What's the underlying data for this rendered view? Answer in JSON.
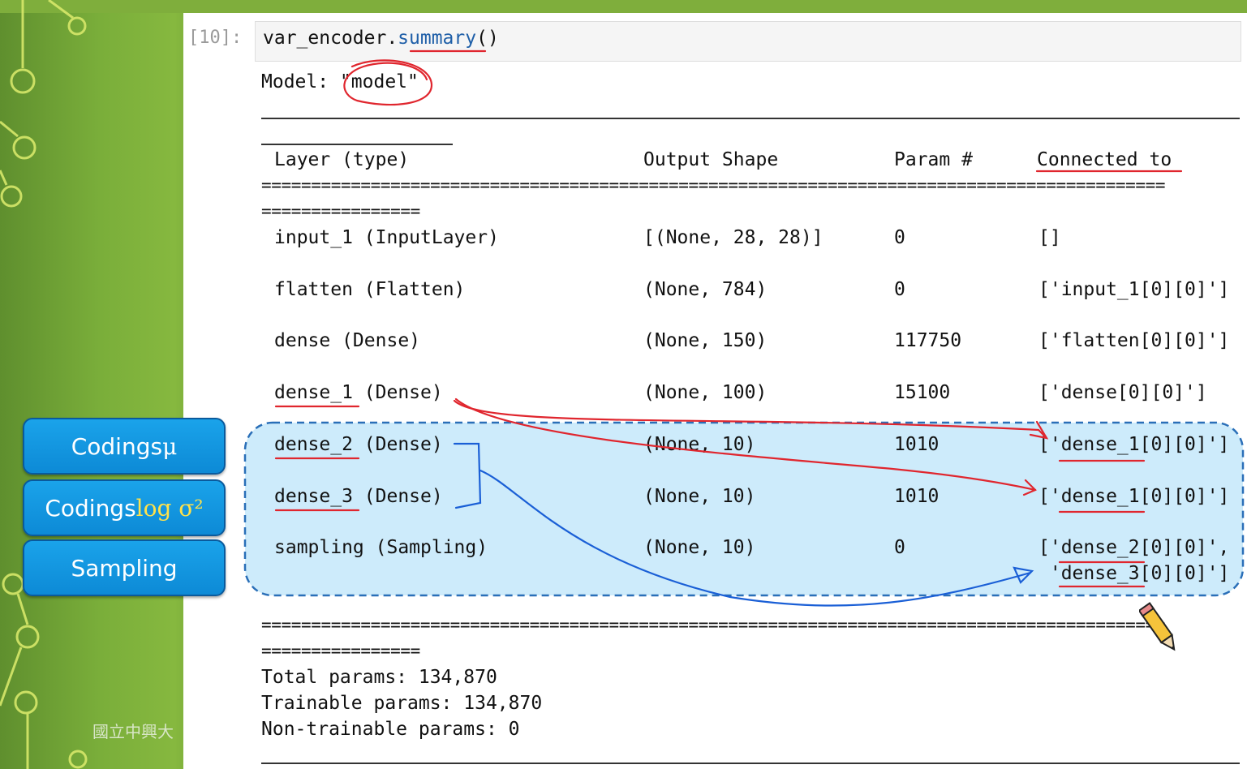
{
  "cell": {
    "prompt": "[10]:",
    "code_object": "var_encoder.",
    "code_method": "summary",
    "code_tail": "()"
  },
  "summary": {
    "model_label": "Model: ",
    "model_name": "\"model\"",
    "headers": {
      "layer": "Layer (type)",
      "output_shape": "Output Shape",
      "params": "Param #",
      "connected": "Connected to"
    },
    "separator_long": "===========================================================================================",
    "separator_short": "================",
    "rows": [
      {
        "layer": "input_1 (InputLayer)",
        "shape": "[(None, 28, 28)]",
        "params": "0",
        "connected": "[]"
      },
      {
        "layer": "flatten (Flatten)",
        "shape": "(None, 784)",
        "params": "0",
        "connected": "['input_1[0][0]']"
      },
      {
        "layer": "dense (Dense)",
        "shape": "(None, 150)",
        "params": "117750",
        "connected": "['flatten[0][0]']"
      },
      {
        "layer": "dense_1 (Dense)",
        "shape": "(None, 100)",
        "params": "15100",
        "connected": "['dense[0][0]']"
      },
      {
        "layer": "dense_2 (Dense)",
        "shape": "(None, 10)",
        "params": "1010",
        "connected": "['dense_1[0][0]']"
      },
      {
        "layer": "dense_3 (Dense)",
        "shape": "(None, 10)",
        "params": "1010",
        "connected": "['dense_1[0][0]']"
      },
      {
        "layer": "sampling (Sampling)",
        "shape": "(None, 10)",
        "params": "0",
        "connected": "['dense_2[0][0]',",
        "connected_2": " 'dense_3[0][0]']"
      }
    ],
    "total": "Total params: 134,870",
    "trainable": "Trainable params: 134,870",
    "non_trainable": "Non-trainable params: 0"
  },
  "side_panel": {
    "mu_label": "Codings ",
    "mu_symbol": "μ",
    "logvar_label": "Codings ",
    "logvar_symbol": "log σ²",
    "sampling_label": "Sampling"
  },
  "footer": {
    "university": "國立中興大"
  },
  "colors": {
    "annotation_red": "#e0262e",
    "annotation_blue": "#1a5fd6",
    "highlight_fill": "#cdebfb",
    "highlight_border": "#2a6fb8",
    "side_button": "#1aa3ea",
    "method_blue": "#1f5fa8"
  }
}
